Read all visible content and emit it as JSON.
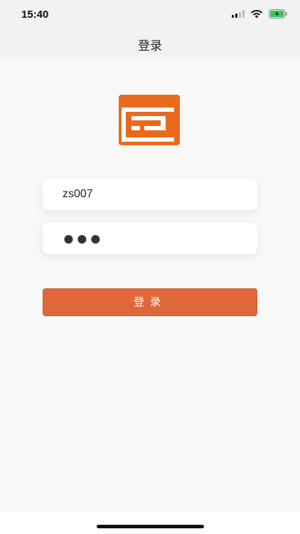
{
  "status_bar": {
    "time": "15:40",
    "icons": [
      "signal-icon",
      "wifi-icon",
      "battery-icon"
    ],
    "battery_color": "#34c759"
  },
  "nav": {
    "title": "登录"
  },
  "login_form": {
    "username_value": "zs007",
    "password_mask": "●●●"
  },
  "login_button": {
    "label": "登录"
  },
  "colors": {
    "brand": "#e96a1d",
    "button": "#e0673a"
  }
}
